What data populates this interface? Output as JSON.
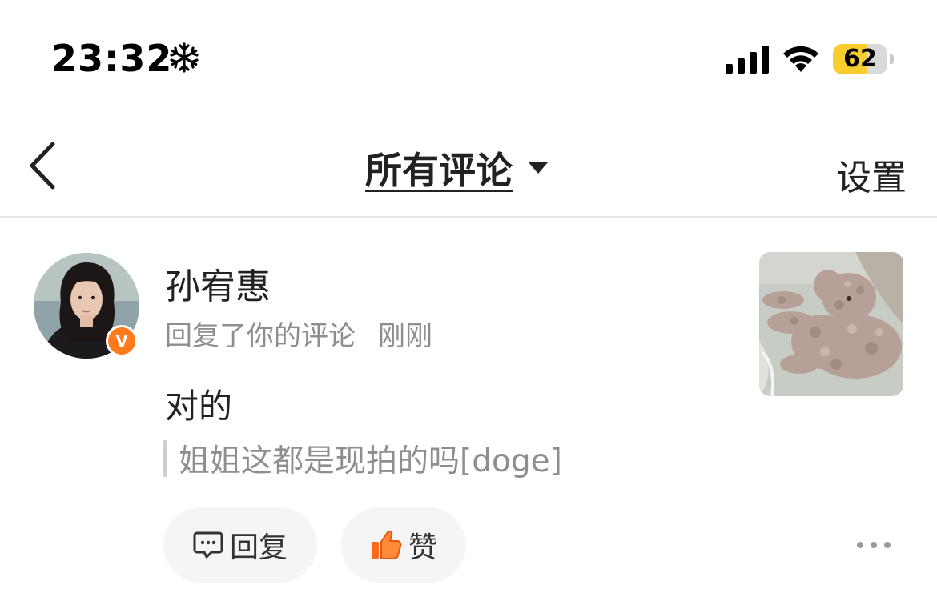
{
  "status_bar": {
    "time": "23:32",
    "status_icon": "snowflake-icon",
    "battery_percent": 62,
    "battery_label": "62",
    "battery_color": "#f7ce2e"
  },
  "nav": {
    "back_icon": "chevron-left-icon",
    "title": "所有评论",
    "dropdown_icon": "caret-down-icon",
    "settings_label": "设置"
  },
  "comment": {
    "avatar": "avatar",
    "verified_badge": "V",
    "verified_color": "#ff7a1a",
    "username": "孙宥惠",
    "action": "回复了你的评论",
    "timestamp": "刚刚",
    "text": "对的",
    "quoted_text": "姐姐这都是现拍的吗[doge]",
    "thumbnail": "poodle-photo"
  },
  "actions": {
    "reply_label": "回复",
    "reply_icon": "comment-bubble-icon",
    "like_label": "赞",
    "like_icon": "thumbs-up-icon",
    "like_color": "#ff6a1a",
    "more_icon": "more-dots-icon"
  }
}
